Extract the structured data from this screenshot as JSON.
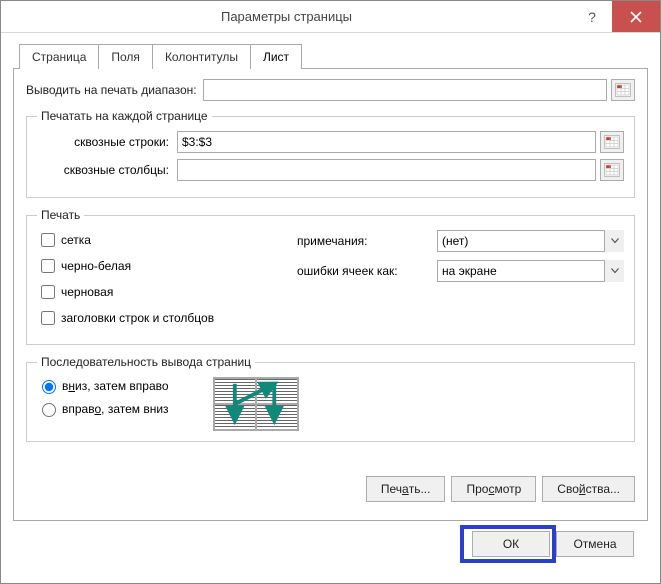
{
  "titlebar": {
    "title": "Параметры страницы"
  },
  "tabs": {
    "page": "Страница",
    "margins": "Поля",
    "headerfooter": "Колонтитулы",
    "sheet": "Лист"
  },
  "labels": {
    "print_range": "Выводить на печать диапазон:",
    "repeat_group": "Печатать на каждой странице",
    "rows_repeat": "сквозные строки:",
    "cols_repeat": "сквозные столбцы:",
    "print_group": "Печать",
    "page_order_group": "Последовательность вывода страниц",
    "comments": "примечания:",
    "cell_errors": "ошибки ячеек как:"
  },
  "values": {
    "print_range": "",
    "rows_repeat": "$3:$3",
    "cols_repeat": "",
    "comments_selected": "(нет)",
    "errors_selected": "на экране"
  },
  "checkboxes": {
    "gridlines": "сетка",
    "bw": "черно-белая",
    "draft": "черновая",
    "headings": "заголовки строк и столбцов"
  },
  "radios": {
    "down_then_over_pre": "в",
    "down_then_over_mid": "н",
    "down_then_over_post": "из, затем вправо",
    "over_then_down_pre": "вправ",
    "over_then_down_mid": "о",
    "over_then_down_post": ", затем вниз"
  },
  "buttons": {
    "print_pre": "Печ",
    "print_mid": "а",
    "print_post": "ть...",
    "preview_pre": "Про",
    "preview_mid": "с",
    "preview_post": "мотр",
    "options_pre": "Сво",
    "options_mid": "й",
    "options_post": "ства...",
    "ok": "ОК",
    "cancel": "Отмена"
  }
}
